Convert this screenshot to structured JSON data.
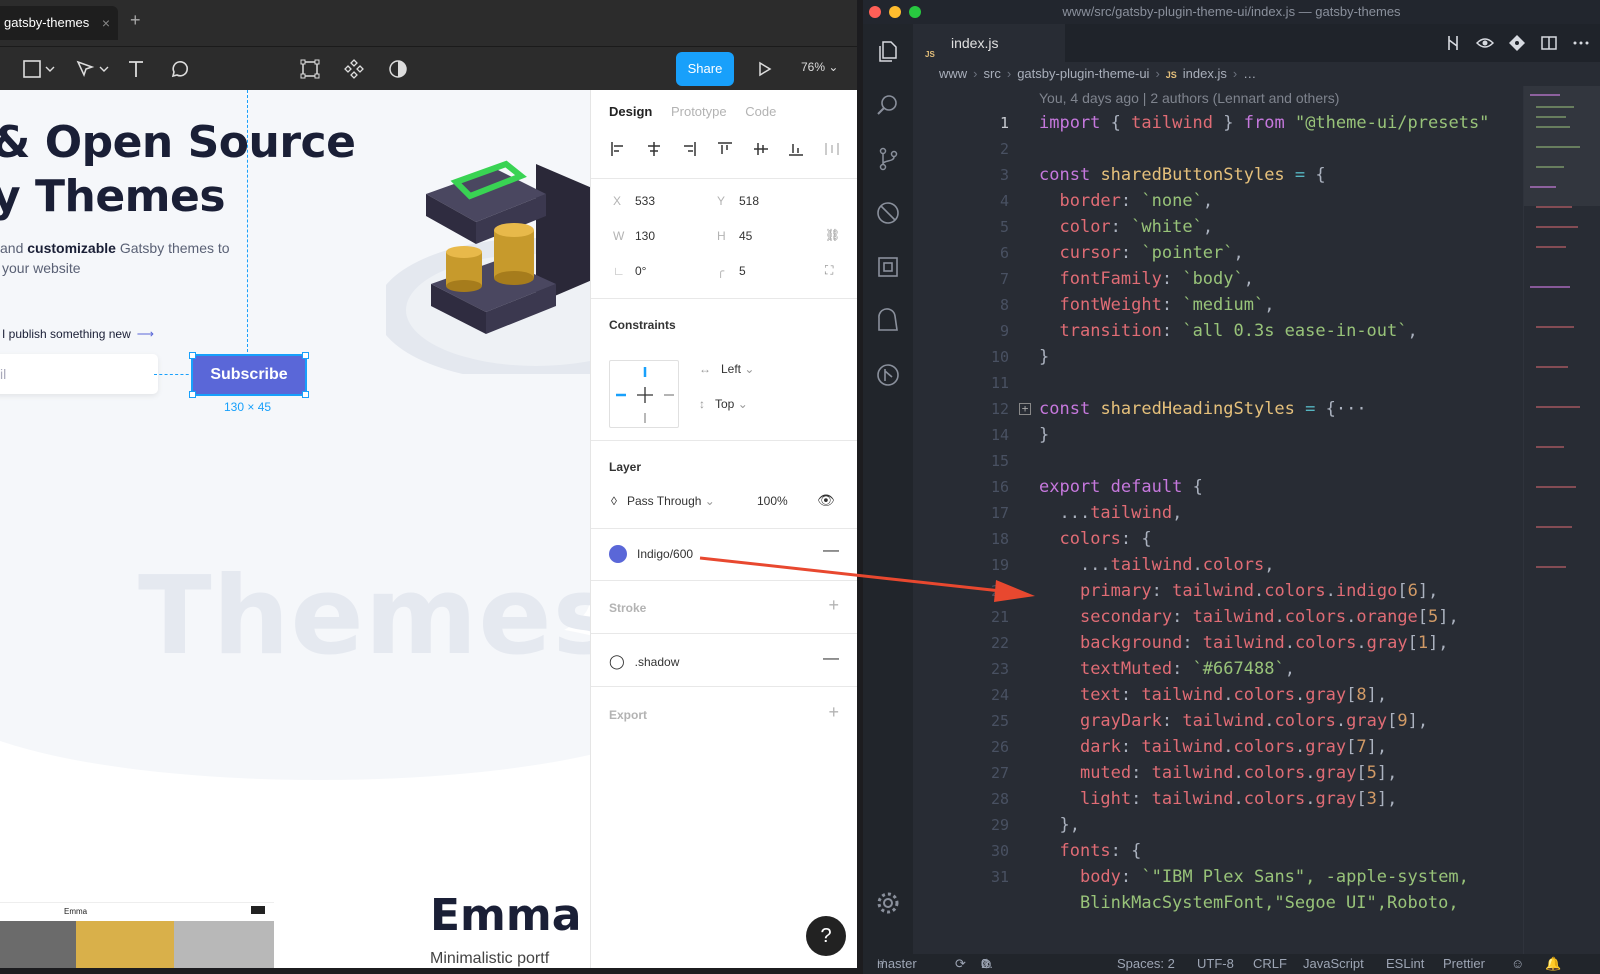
{
  "figma": {
    "tab_title": "gatsby-themes",
    "tab_close": "×",
    "tab_add": "+",
    "share_label": "Share",
    "zoom_label": "76%",
    "canvas": {
      "hero_line1": "& Open Source",
      "hero_line2": "y Themes",
      "hero_text_pre": "and ",
      "hero_text_bold": "customizable",
      "hero_text_post": " Gatsby themes to",
      "hero_text_line2": "your website",
      "notify_text": "I publish something new",
      "email_placeholder": "il",
      "subscribe_label": "Subscribe",
      "size_label": "130 × 45",
      "themes_watermark": "Themes",
      "emma_mini_title": "Emma",
      "emma_heading": "Emma",
      "emma_sub": "Minimalistic portf"
    },
    "help_label": "?",
    "panel": {
      "tabs": [
        "Design",
        "Prototype",
        "Code"
      ],
      "x_label": "X",
      "x_value": "533",
      "y_label": "Y",
      "y_value": "518",
      "w_label": "W",
      "w_value": "130",
      "h_label": "H",
      "h_value": "45",
      "rotation_value": "0°",
      "radius_value": "5",
      "constraints_title": "Constraints",
      "constraint_h": "Left",
      "constraint_v": "Top",
      "layer_title": "Layer",
      "blend_mode": "Pass Through",
      "opacity": "100%",
      "fill_name": "Indigo/600",
      "fill_color": "#5a67d8",
      "stroke_title": "Stroke",
      "effect_name": ".shadow",
      "export_title": "Export"
    }
  },
  "vscode": {
    "window_title": "www/src/gatsby-plugin-theme-ui/index.js — gatsby-themes",
    "tab_label": "index.js",
    "tab_icon": "JS",
    "breadcrumbs": [
      "www",
      "src",
      "gatsby-plugin-theme-ui",
      "index.js",
      "…"
    ],
    "blame": "You, 4 days ago | 2 authors (Lennart and others)",
    "line_numbers": [
      "1",
      "2",
      "3",
      "4",
      "5",
      "6",
      "7",
      "8",
      "9",
      "10",
      "11",
      "12",
      "14",
      "15",
      "16",
      "17",
      "18",
      "19",
      "20",
      "21",
      "22",
      "23",
      "24",
      "25",
      "26",
      "27",
      "28",
      "29",
      "30",
      "31"
    ],
    "status": {
      "branch": "master",
      "errors": "0",
      "warnings": "0",
      "spaces": "Spaces: 2",
      "encoding": "UTF-8",
      "eol": "CRLF",
      "language": "JavaScript",
      "eslint": "ESLint",
      "prettier": "Prettier"
    }
  },
  "colors": {
    "figma_blue": "#18a0fb",
    "indigo_600": "#5a67d8",
    "annotation_arrow": "#e8482f"
  }
}
